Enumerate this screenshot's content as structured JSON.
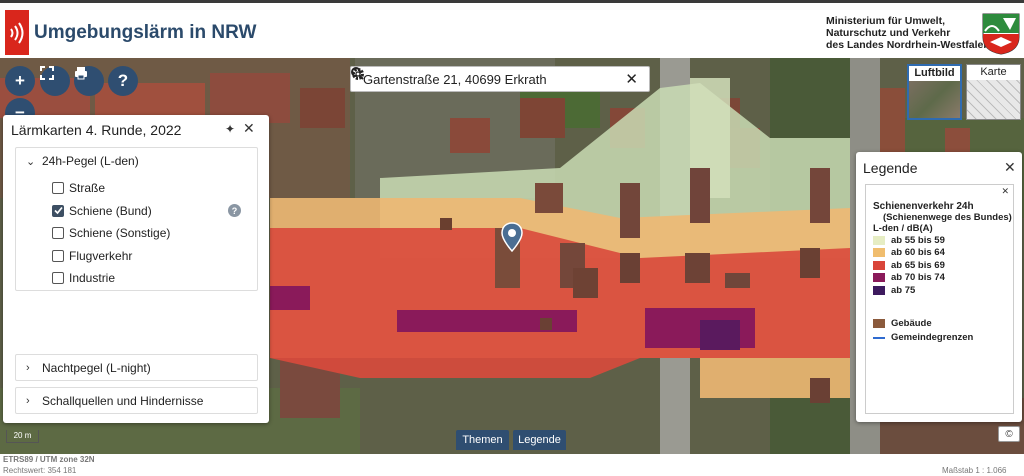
{
  "header": {
    "app_title": "Umgebungslärm in NRW",
    "ministry": "Ministerium für Umwelt,\nNaturschutz und Verkehr\ndes Landes Nordrhein-Westfalen"
  },
  "toolbar": {
    "zoom_in": "+",
    "zoom_out": "−",
    "help": "?"
  },
  "search": {
    "value": "Gartenstraße 21, 40699 Erkrath"
  },
  "basemaps": {
    "luftbild": "Luftbild",
    "karte": "Karte",
    "active": "Luftbild"
  },
  "layer_panel": {
    "title": "Lärmkarten 4. Runde, 2022",
    "groups": [
      {
        "label": "24h-Pegel (L-den)",
        "expanded": true,
        "items": [
          {
            "label": "Straße",
            "checked": false
          },
          {
            "label": "Schiene (Bund)",
            "checked": true
          },
          {
            "label": "Schiene (Sonstige)",
            "checked": false
          },
          {
            "label": "Flugverkehr",
            "checked": false
          },
          {
            "label": "Industrie",
            "checked": false
          }
        ]
      },
      {
        "label": "Nachtpegel (L-night)",
        "expanded": false
      },
      {
        "label": "Schallquellen und Hindernisse",
        "expanded": false
      }
    ]
  },
  "legend": {
    "title": "Legende",
    "heading": "Schienenverkehr 24h",
    "subheading": "(Schienenwege des Bundes)",
    "unit": "L-den / dB(A)",
    "classes": [
      {
        "label": "ab 55 bis 59",
        "color": "#e6edc3"
      },
      {
        "label": "ab 60 bis 64",
        "color": "#f0bd6e"
      },
      {
        "label": "ab 65 bis 69",
        "color": "#d9453a"
      },
      {
        "label": "ab 70 bis 74",
        "color": "#8a1a5a"
      },
      {
        "label": "ab 75",
        "color": "#3d1a5e"
      }
    ],
    "extras": [
      {
        "label": "Gebäude",
        "color": "#8b5a3c"
      },
      {
        "label": "Gemeindegrenzen",
        "color": "#2f6bd0"
      }
    ]
  },
  "bottom_tabs": {
    "themen": "Themen",
    "legende": "Legende"
  },
  "scale": {
    "bar_label": "20 m",
    "ratio": "Maßstab 1 : 1.066"
  },
  "coordinates": {
    "crs": "ETRS89 / UTM zone 32N",
    "rechtswert": "Rechtswert: 354 181"
  },
  "colors": {
    "brand_blue": "#2f4e71",
    "logo_red": "#d9261c"
  }
}
